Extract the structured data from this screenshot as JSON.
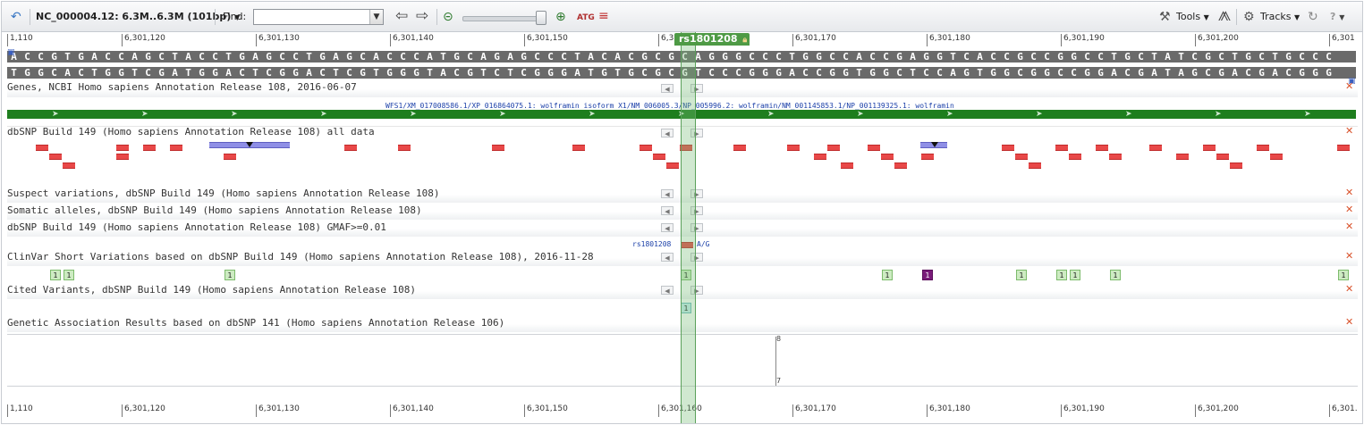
{
  "toolbar": {
    "undo_icon": "undo-icon",
    "sequence_label": "NC_000004.12: 6.3M..6.3M (101bp)",
    "find_label": "Find:",
    "find_value": "",
    "tools_label": "Tools",
    "tracks_label": "Tracks",
    "help_label": "?"
  },
  "ruler": {
    "labels": [
      "1,110",
      "6,301,120",
      "6,301,130",
      "6,301,140",
      "6,301,150",
      "6,301,160",
      "6,301,170",
      "6,301,180",
      "6,301,190",
      "6,301,200",
      "6,301"
    ]
  },
  "bottom_ruler": {
    "labels": [
      "1,110",
      "6,301,120",
      "6,301,130",
      "6,301,140",
      "6,301,150",
      "6,301,160",
      "6,301,170",
      "6,301,180",
      "6,301,190",
      "6,301,200",
      "6,301."
    ]
  },
  "sequence": {
    "top": "ACCGTGACCAGCTACCTGAGCCTGAGCACCCATGCAGAGCCCTACACGCGCAGGGCCCTGGCCACCGAGGTCACCGCCGGCCTGCTATCGCTGCTGCCC",
    "bottom": "TGGCACTGGTCGATGGACTCGGACTCGTGGGTACGTCTCGGGATGTGCGCGTCCCGGGACCGGTGGCTCCAGTGGCGGCCGGACGATAGCGACGACGGG"
  },
  "marker": {
    "label": "rs1801208"
  },
  "tracks": {
    "genes": "Genes, NCBI Homo sapiens Annotation Release 108, 2016-06-07",
    "gene_label": "WFS1/XM_017008586.1/XP_016864075.1: wolframin isoform X1/NM_006005.3/NP_005996.2: wolframin/NM_001145853.1/NP_001139325.1: wolframin",
    "dbsnp": "dbSNP Build 149 (Homo sapiens Annotation Release 108) all data",
    "suspect": "Suspect variations, dbSNP Build 149 (Homo sapiens Annotation Release 108)",
    "somatic": "Somatic alleles, dbSNP Build 149 (Homo sapiens Annotation Release 108)",
    "gmaf": "dbSNP Build 149 (Homo sapiens Annotation Release 108) GMAF>=0.01",
    "gmaf_snp_name": "rs1801208",
    "gmaf_snp_allele": "A/G",
    "clinvar": "ClinVar Short Variations based on dbSNP Build 149 (Homo sapiens Annotation Release 108), 2016-11-28",
    "cited": "Cited Variants, dbSNP Build 149 (Homo sapiens Annotation Release 108)",
    "gwas": "Genetic Association Results based on dbSNP 141 (Homo sapiens Annotation Release 106)"
  },
  "clinvar_count": "1",
  "cited_count": "1",
  "graph": {
    "y_top": "8",
    "y_bottom": "7"
  }
}
